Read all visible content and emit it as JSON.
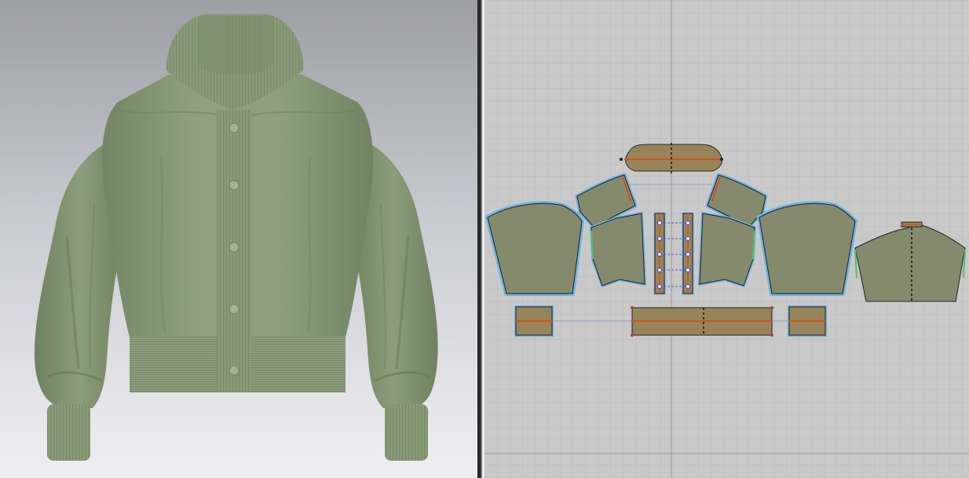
{
  "window": {
    "layout": "split-view",
    "left_panel": "3d-garment-view",
    "right_panel": "2d-pattern-view"
  },
  "garment": {
    "type": "cropped bomber jacket",
    "fabric_color": "#8c9e7b",
    "fabric_shadow": "#6d7f5e",
    "button_count": 5
  },
  "pattern": {
    "piece_fill": "#858a6c",
    "rib_fill": "#97845a",
    "selection_outline_color": "#6cb4e8",
    "seam_line_color": "#d4511e",
    "sewing_point_color": "#5a4be0",
    "notch_color": "#4fc36a",
    "grid_bg": "#c9c9c9"
  },
  "colors": {
    "splitter": "#2b2b2b"
  }
}
